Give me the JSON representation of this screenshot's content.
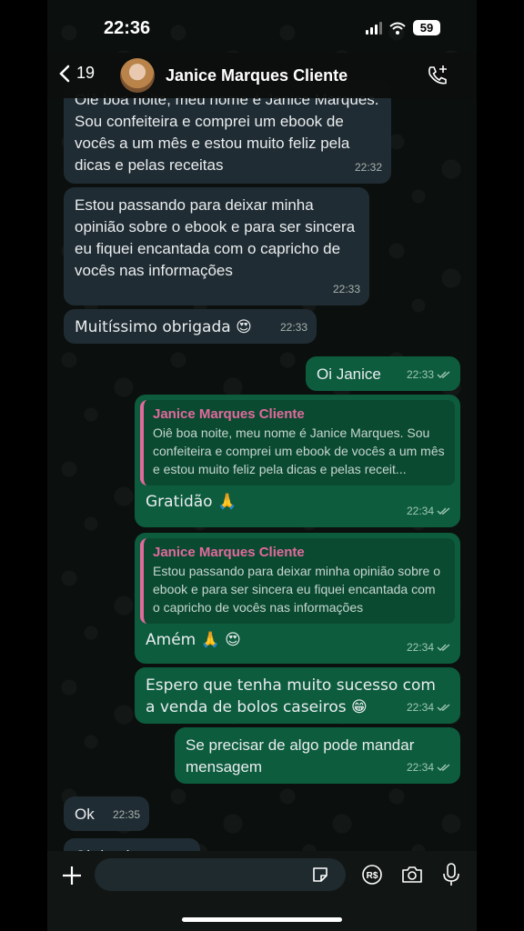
{
  "status": {
    "time": "22:36",
    "battery": "59"
  },
  "header": {
    "back_count": "19",
    "contact_name": "Janice Marques Cliente"
  },
  "messages": [
    {
      "text": "Oiê boa noite, meu nome é Janice Marques. Sou confeiteira e comprei um ebook de vocês a um mês e estou muito feliz pela dicas e pelas receitas",
      "time": "22:32"
    },
    {
      "text": "Estou passando para deixar minha opinião sobre o ebook e para ser sincera eu fiquei encantada com o capricho de vocês nas informações",
      "time": "22:33"
    },
    {
      "text": "Muitíssimo obrigada 😍",
      "time": "22:33"
    },
    {
      "text": "Oi Janice",
      "time": "22:33"
    },
    {
      "quote_name": "Janice Marques Cliente",
      "quote_text": "Oiê boa noite, meu nome é Janice Marques. Sou confeiteira e comprei um ebook de vocês a um mês e estou muito feliz pela dicas e pelas receit...",
      "text": "Gratidão 🙏",
      "time": "22:34"
    },
    {
      "quote_name": "Janice Marques Cliente",
      "quote_text": "Estou passando para deixar minha opinião sobre o ebook e para ser sincera eu fiquei encantada com o capricho de vocês nas informações",
      "text": "Amém 🙏 😍",
      "time": "22:34"
    },
    {
      "text": "Espero que tenha muito sucesso com a venda de bolos caseiros 😁",
      "time": "22:34"
    },
    {
      "text": "Se precisar de algo pode mandar mensagem",
      "time": "22:34"
    },
    {
      "text": "Ok",
      "time": "22:35"
    },
    {
      "text": "Obrigada",
      "time": ""
    }
  ],
  "icons": {
    "back": "chevron-left-icon",
    "call": "add-call-icon",
    "plus": "plus-icon",
    "sticker": "sticker-icon",
    "pay": "payment-icon",
    "camera": "camera-icon",
    "mic": "microphone-icon",
    "read": "double-check-icon"
  },
  "colors": {
    "outgoing": "#0d5c3e",
    "incoming": "#202c33",
    "quote_accent": "#e26a9c"
  }
}
